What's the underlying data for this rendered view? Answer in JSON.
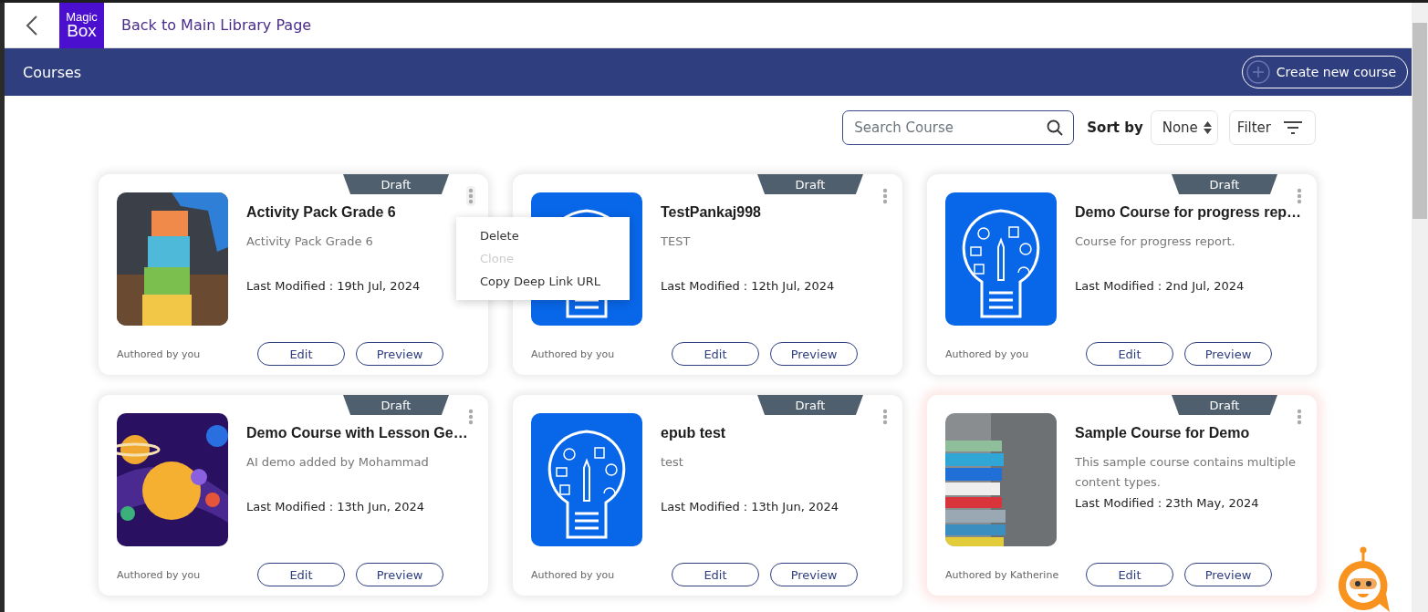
{
  "header": {
    "logo": {
      "line1": "Magic",
      "line2": "Box"
    },
    "back_link": "Back to Main Library Page"
  },
  "title_bar": {
    "title": "Courses",
    "create_button": "Create new course"
  },
  "toolbar": {
    "search": {
      "placeholder": "Search Course"
    },
    "sort_label": "Sort by",
    "sort_value": "None",
    "filter_label": "Filter"
  },
  "courses": [
    {
      "status": "Draft",
      "kind": "picture",
      "title": "Activity Pack Grade 6",
      "description": "Activity Pack Grade 6",
      "modified": "Last Modified : 19th Jul, 2024",
      "author": "Authored by you",
      "edit_button": "Edit",
      "preview_button": "Preview",
      "menu_open": true,
      "highlighted": false
    },
    {
      "status": "Draft",
      "kind": "illustration",
      "title": "TestPankaj998",
      "description": "TEST",
      "modified": "Last Modified : 12th Jul, 2024",
      "author": "Authored by you",
      "edit_button": "Edit",
      "preview_button": "Preview",
      "menu_open": false,
      "highlighted": false
    },
    {
      "status": "Draft",
      "kind": "illustration",
      "title": "Demo Course for progress rep…",
      "description": "Course for progress report.",
      "modified": "Last Modified : 2nd Jul, 2024",
      "author": "Authored by you",
      "edit_button": "Edit",
      "preview_button": "Preview",
      "menu_open": false,
      "highlighted": false
    },
    {
      "status": "Draft",
      "kind": "picture",
      "title": "Demo Course with Lesson Ge…",
      "description": "AI demo added by Mohammad",
      "modified": "Last Modified : 13th Jun, 2024",
      "author": "Authored by you",
      "edit_button": "Edit",
      "preview_button": "Preview",
      "menu_open": false,
      "highlighted": false
    },
    {
      "status": "Draft",
      "kind": "illustration",
      "title": "epub test",
      "description": "test",
      "modified": "Last Modified : 13th Jun, 2024",
      "author": "Authored by you",
      "edit_button": "Edit",
      "preview_button": "Preview",
      "menu_open": false,
      "highlighted": false
    },
    {
      "status": "Draft",
      "kind": "picture",
      "title": "Sample Course for Demo",
      "description": "This sample course contains multiple content types.",
      "modified": "Last Modified : 23th May, 2024",
      "author": "Authored by Katherine",
      "edit_button": "Edit",
      "preview_button": "Preview",
      "menu_open": false,
      "highlighted": true
    }
  ],
  "context_menu": [
    {
      "label": "Delete",
      "disabled": false
    },
    {
      "label": "Clone",
      "disabled": true
    },
    {
      "label": "Copy Deep Link URL",
      "disabled": false
    }
  ]
}
